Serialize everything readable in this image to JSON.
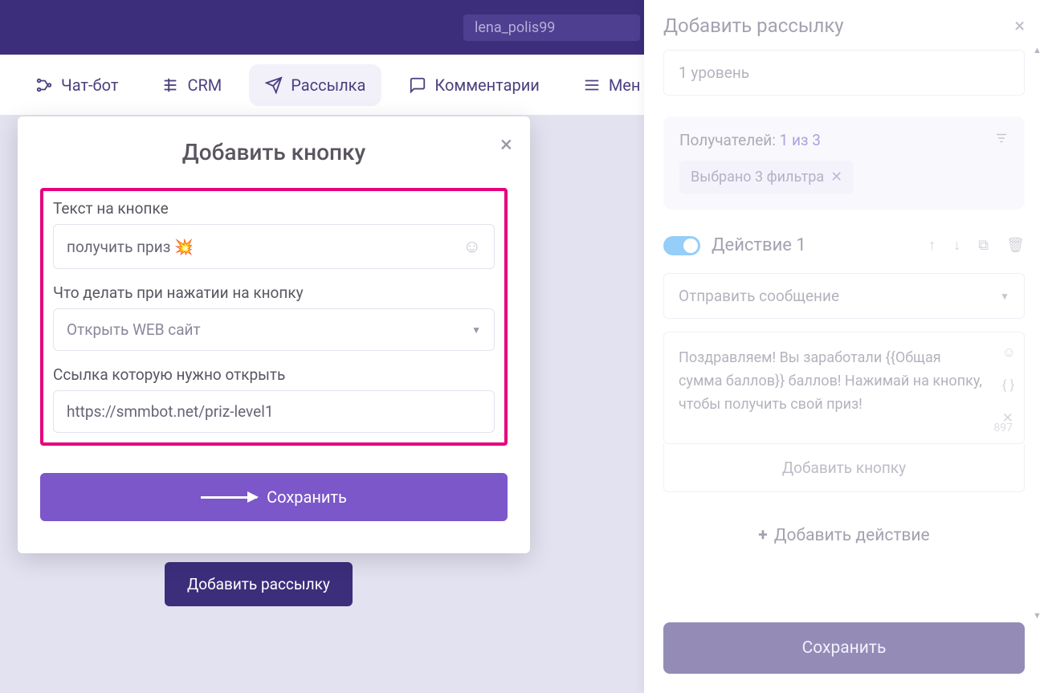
{
  "topbar": {
    "search_value": "lena_polis99"
  },
  "tabs": {
    "chatbot": "Чат-бот",
    "crm": "CRM",
    "broadcast": "Рассылка",
    "comments": "Комментарии",
    "menu": "Мен"
  },
  "background": {
    "add_broadcast": "Добавить рассылку"
  },
  "modal": {
    "title": "Добавить кнопку",
    "label_text": "Текст на кнопке",
    "text_value": "получить приз 💥",
    "label_action": "Что делать при нажатии на кнопку",
    "action_value": "Открыть WEB сайт",
    "label_link": "Ссылка которую нужно открыть",
    "link_value": "https://smmbot.net/priz-level1",
    "save": "Сохранить"
  },
  "side": {
    "title": "Добавить рассылку",
    "level": "1 уровень",
    "recipients_label": "Получателей:",
    "recipients_count": "1 из 3",
    "filter_chip": "Выбрано 3 фильтра",
    "action_name": "Действие 1",
    "action_type": "Отправить сообщение",
    "message": "Поздравляем! Вы заработали  {{Общая сумма баллов}} баллов! Нажимай на кнопку, чтобы получить свой приз!",
    "msg_count": "897",
    "add_button": "Добавить кнопку",
    "add_action": "Добавить действие",
    "save": "Сохранить"
  }
}
